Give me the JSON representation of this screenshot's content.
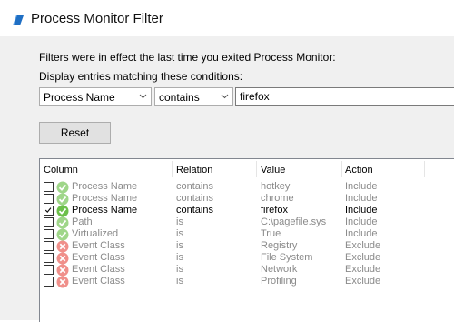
{
  "window": {
    "title": "Process Monitor Filter"
  },
  "info": {
    "line1": "Filters were in effect the last time you exited Process Monitor:",
    "line2": "Display entries matching these conditions:"
  },
  "condition": {
    "column": "Process Name",
    "relation": "contains",
    "value": "firefox"
  },
  "buttons": {
    "reset": "Reset"
  },
  "list": {
    "headers": [
      "Column",
      "Relation",
      "Value",
      "Action"
    ],
    "rows": [
      {
        "checked": false,
        "status": "include",
        "column": "Process Name",
        "relation": "contains",
        "value": "hotkey",
        "action": "Include"
      },
      {
        "checked": false,
        "status": "include",
        "column": "Process Name",
        "relation": "contains",
        "value": "chrome",
        "action": "Include"
      },
      {
        "checked": true,
        "status": "include",
        "column": "Process Name",
        "relation": "contains",
        "value": "firefox",
        "action": "Include"
      },
      {
        "checked": false,
        "status": "include",
        "column": "Path",
        "relation": "is",
        "value": "C:\\pagefile.sys",
        "action": "Include"
      },
      {
        "checked": false,
        "status": "include",
        "column": "Virtualized",
        "relation": "is",
        "value": "True",
        "action": "Include"
      },
      {
        "checked": false,
        "status": "exclude",
        "column": "Event Class",
        "relation": "is",
        "value": "Registry",
        "action": "Exclude"
      },
      {
        "checked": false,
        "status": "exclude",
        "column": "Event Class",
        "relation": "is",
        "value": "File System",
        "action": "Exclude"
      },
      {
        "checked": false,
        "status": "exclude",
        "column": "Event Class",
        "relation": "is",
        "value": "Network",
        "action": "Exclude"
      },
      {
        "checked": false,
        "status": "exclude",
        "column": "Event Class",
        "relation": "is",
        "value": "Profiling",
        "action": "Exclude"
      }
    ]
  },
  "colors": {
    "include": "#6cc04a",
    "exclude": "#e8534b",
    "app_icon": "#1f6fc4"
  }
}
